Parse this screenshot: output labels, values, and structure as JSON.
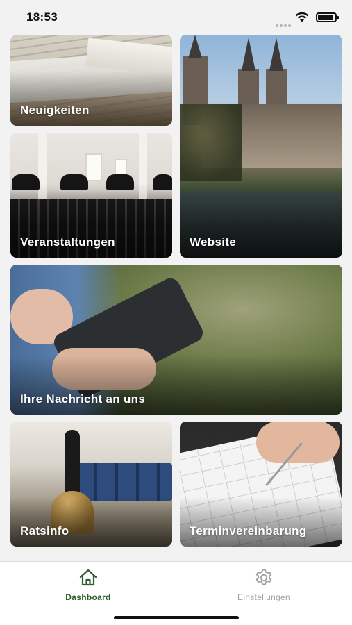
{
  "status_bar": {
    "time": "18:53",
    "signal_icon": "cellular-dots",
    "wifi_icon": "wifi-icon",
    "battery_icon": "battery-icon"
  },
  "tiles": {
    "news": {
      "label": "Neuigkeiten"
    },
    "events": {
      "label": "Veranstaltungen"
    },
    "website": {
      "label": "Website"
    },
    "message": {
      "label": "Ihre Nachricht an uns"
    },
    "ratsinfo": {
      "label": "Ratsinfo"
    },
    "appointment": {
      "label": "Terminvereinbarung"
    }
  },
  "tab_bar": {
    "dashboard": {
      "label": "Dashboard",
      "icon": "home-icon",
      "active": true
    },
    "settings": {
      "label": "Einstellungen",
      "icon": "gear-icon",
      "active": false
    }
  },
  "colors": {
    "accent": "#2f5d2e",
    "inactive": "#a3a3a3",
    "background": "#f2f2f2"
  }
}
